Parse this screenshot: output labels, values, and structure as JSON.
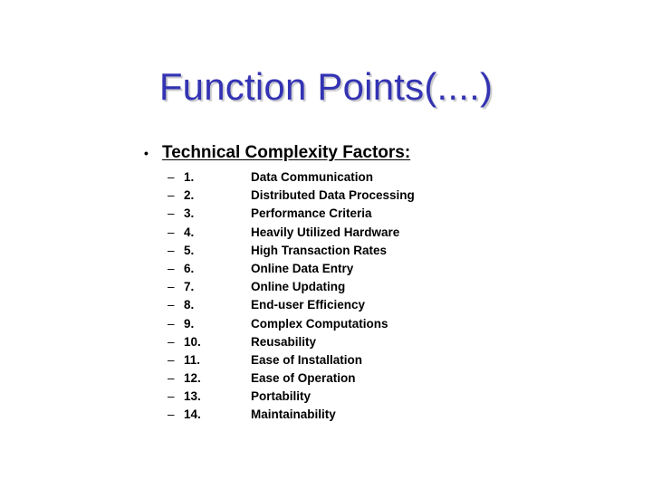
{
  "slide": {
    "title": "Function Points(....)",
    "bullet_symbol": "•",
    "heading": "Technical Complexity Factors:",
    "dash_symbol": "–",
    "factors": [
      {
        "number": "1.",
        "label": "Data Communication"
      },
      {
        "number": "2.",
        "label": "Distributed Data Processing"
      },
      {
        "number": "3.",
        "label": "Performance Criteria"
      },
      {
        "number": "4.",
        "label": "Heavily Utilized Hardware"
      },
      {
        "number": "5.",
        "label": "High Transaction Rates"
      },
      {
        "number": "6.",
        "label": "Online Data Entry"
      },
      {
        "number": "7.",
        "label": "Online Updating"
      },
      {
        "number": "8.",
        "label": "End-user Efficiency"
      },
      {
        "number": "9.",
        "label": "Complex Computations"
      },
      {
        "number": "10.",
        "label": "Reusability"
      },
      {
        "number": "11.",
        "label": "Ease of Installation"
      },
      {
        "number": "12.",
        "label": "Ease of Operation"
      },
      {
        "number": "13.",
        "label": "Portability"
      },
      {
        "number": "14.",
        "label": "Maintainability"
      }
    ]
  },
  "colors": {
    "title": "#3333b3",
    "body_text": "#000000",
    "background": "#ffffff"
  }
}
